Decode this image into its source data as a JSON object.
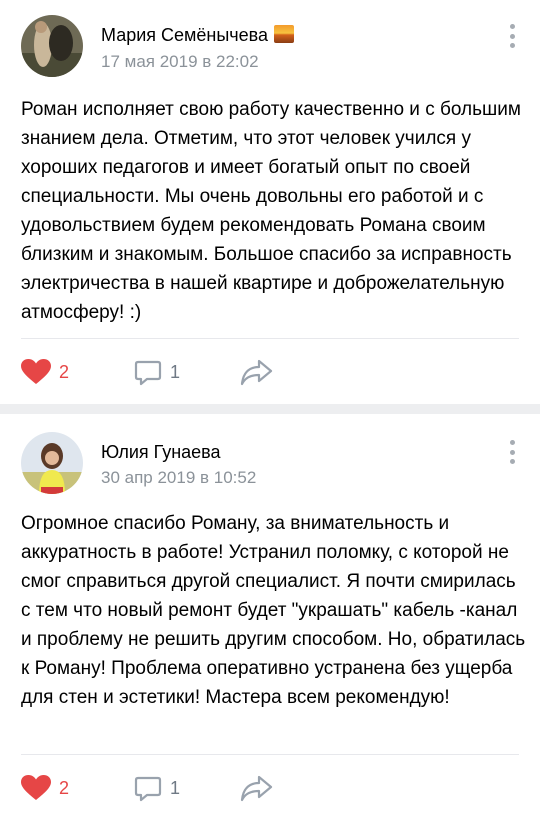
{
  "posts": [
    {
      "author": "Мария Семёнычева",
      "date": "17 мая 2019 в 22:02",
      "text": "Роман исполняет свою работу качественно и с большим знанием дела. Отметим, что этот человек учился у хороших педагогов и имеет богатый опыт по своей специальности. Мы очень довольны его работой и с удовольствием будем рекомендовать Романа своим близким и знакомым. Большое спасибо за исправность электричества в нашей квартире и доброжелательную атмосферу! :)",
      "likes": "2",
      "comments": "1"
    },
    {
      "author": "Юлия Гунаева",
      "date": "30 апр 2019 в 10:52",
      "text": "Огромное спасибо Роману, за внимательность и аккуратность в работе! Устранил поломку, с которой не смог справиться другой специалист. Я почти смирилась с тем что новый ремонт будет \"украшать\" кабель -канал и проблему не решить другим способом. Но, обратилась к Роману! Проблема оперативно устранена без ущерба для стен и эстетики! Мастера всем рекомендую!",
      "likes": "2",
      "comments": "1"
    }
  ],
  "icons": {
    "like": "heart-icon",
    "comment": "comment-icon",
    "share": "share-arrow-icon",
    "menu": "more-vertical-icon",
    "badge": "sunset-emoji-icon"
  },
  "colors": {
    "like": "#e64646",
    "secondary_text": "#8b9299",
    "icon": "#99a2ad",
    "separator": "#edeef0"
  }
}
